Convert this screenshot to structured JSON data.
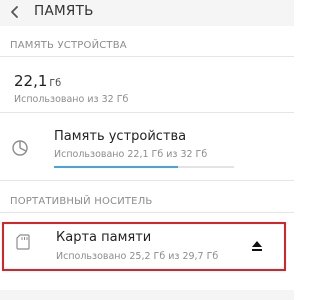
{
  "header": {
    "title": "ПАМЯТЬ"
  },
  "device_section": {
    "label": "ПАМЯТЬ УСТРОЙСТВА",
    "used_value": "22,1",
    "used_unit": "Гб",
    "used_desc": "Использовано из 32 Гб"
  },
  "device_item": {
    "title": "Память устройства",
    "desc": "Использовано 22,1 Гб из 32 Гб",
    "progress": 0.69
  },
  "portable_section": {
    "label": "ПОРТАТИВНЫЙ НОСИТЕЛЬ"
  },
  "sd_item": {
    "title": "Карта памяти",
    "desc": "Использовано 25,2 Гб из 29,7 Гб"
  },
  "colors": {
    "accent": "#4aa3df",
    "highlight": "#e31e24"
  },
  "icons": {
    "back": "back-arrow-icon",
    "storage": "pie-chart-icon",
    "sd": "sd-card-icon",
    "eject": "eject-icon"
  }
}
